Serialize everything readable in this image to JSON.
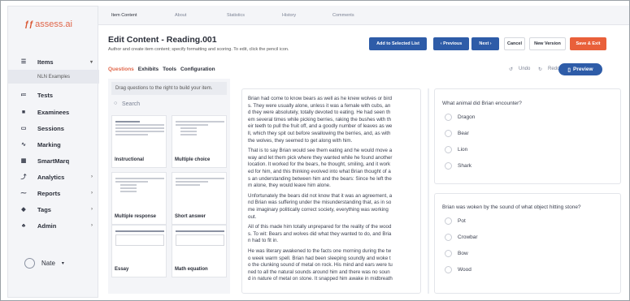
{
  "app": {
    "logo_text": "assess.ai"
  },
  "sidebar": {
    "items": [
      {
        "label": "Items",
        "icon": "menu-icon",
        "chevron": true
      },
      {
        "label": "Tests",
        "icon": "list-icon",
        "chevron": false
      },
      {
        "label": "Examinees",
        "icon": "person-icon",
        "chevron": false
      },
      {
        "label": "Sessions",
        "icon": "calendar-icon",
        "chevron": false
      },
      {
        "label": "Marking",
        "icon": "pulse-icon",
        "chevron": false
      },
      {
        "label": "SmartMarq",
        "icon": "grid-icon",
        "chevron": false
      },
      {
        "label": "Analytics",
        "icon": "trend-icon",
        "chevron": true
      },
      {
        "label": "Reports",
        "icon": "chart-icon",
        "chevron": true
      },
      {
        "label": "Tags",
        "icon": "tag-icon",
        "chevron": true
      },
      {
        "label": "Admin",
        "icon": "admin-icon",
        "chevron": true
      }
    ],
    "sub_item": "NLN Examples",
    "user": "Nate"
  },
  "top_tabs": [
    "Item Content",
    "About",
    "Statistics",
    "History",
    "Comments"
  ],
  "header": {
    "title": "Edit Content - Reading.001",
    "subtitle": "Author and create item content; specify formatting and scoring. To edit, click the pencil icon."
  },
  "buttons": {
    "add_to_list": "Add to Selected List",
    "previous": "‹  Previous",
    "next": "Next  ›",
    "cancel": "Cancel",
    "new_version": "New Version",
    "save_exit": "Save & Exit"
  },
  "subtabs": [
    "Questions",
    "Exhibits",
    "Tools",
    "Configuration"
  ],
  "toolbar": {
    "undo": "Undo",
    "redo": "Redo",
    "preview": "Preview"
  },
  "left_panel": {
    "drag_note": "Drag questions to the right to build your item.",
    "search_placeholder": "Search",
    "cards": [
      "Instructional",
      "Multiple choice",
      "Multiple response",
      "Short answer",
      "Essay",
      "Math equation"
    ]
  },
  "passage": [
    "Brian had come to know bears as well as he knew wolves or bird",
    "s. They were usually alone, unless it was a female with cubs, an",
    "d they were absolutely, totally devoted to eating. He had seen th",
    "em several times while picking berries, raking the bushes with th",
    "eir teeth to pull the fruit off, and a goodly number of leaves as we",
    "ll, which they spit out before swallowing the berries, and, as with",
    "the wolves, they seemed to get along with him.",
    "That is to say Brian would see them eating and he would move a",
    "way and let them pick where they wanted while he found another",
    " location. It worked for the bears, he thought, smiling, and it work",
    "ed for him, and this thinking evolved into what Brian thought of a",
    "s an understanding between him and the bears: Since he left the",
    "m alone, they would leave him alone.",
    "Unfortunately the bears did not know that it was an agreement, a",
    "nd Brian was suffering under the misunderstanding that, as in so",
    "me imaginary politically correct society, everything was working",
    "out.",
    "All of this made him totally unprepared for the reality of the wood",
    "s. To wit: Bears and wolves did what they wanted to do, and Bria",
    "n had to fit in.",
    "He was literary awakened to the facts one morning during the tw",
    "o week warm spell. Brian had been sleeping soundly and woke t",
    "o the clunking sound of metal on rock. His mind and ears were tu",
    "ned to all the natural sounds around him and there was no soun",
    "d in nature of metal on stone. It snapped him awake in midbreath"
  ],
  "questions": [
    {
      "text": "What animal did Brian encounter?",
      "options": [
        "Dragon",
        "Bear",
        "Lion",
        "Shark"
      ]
    },
    {
      "text": "Brian was woken by the sound of what object hitting stone?",
      "options": [
        "Pot",
        "Crowbar",
        "Bow",
        "Wood"
      ]
    }
  ]
}
